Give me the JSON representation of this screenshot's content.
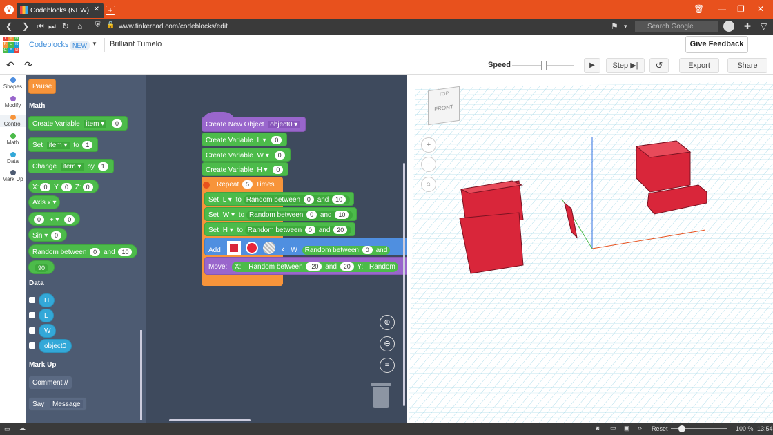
{
  "browser": {
    "tab_title": "Codeblocks (NEW)",
    "url": "www.tinkercad.com/codeblocks/edit",
    "search_placeholder": "Search Google",
    "clock": "13:54",
    "zoom": "100 %",
    "reset_label": "Reset"
  },
  "header": {
    "logo_letters": [
      "T",
      "I",
      "N",
      "K",
      "E",
      "R",
      "C",
      "A",
      "D"
    ],
    "app_name": "Codeblocks",
    "badge": "NEW",
    "project_name": "Brilliant Tumelo",
    "feedback_label": "Give Feedback"
  },
  "toolbar": {
    "speed_label": "Speed",
    "step_label": "Step",
    "export_label": "Export",
    "share_label": "Share"
  },
  "categories": [
    {
      "label": "Shapes",
      "color": "#4f8fe0"
    },
    {
      "label": "Modify",
      "color": "#9966cc"
    },
    {
      "label": "Control",
      "color": "#f7943a"
    },
    {
      "label": "Math",
      "color": "#4cbb4a"
    },
    {
      "label": "Data",
      "color": "#33a8d8"
    },
    {
      "label": "Mark Up",
      "color": "#4d5b72"
    }
  ],
  "palette": {
    "pause": "Pause",
    "math_header": "Math",
    "create_variable": "Create Variable",
    "item": "item",
    "zero": "0",
    "one": "1",
    "set": "Set",
    "to": "to",
    "change": "Change",
    "by": "by",
    "x": "X:",
    "y": "Y:",
    "z": "Z:",
    "axis": "Axis x",
    "plus": "+",
    "sin": "Sin",
    "random_between": "Random between",
    "and": "and",
    "ten": "10",
    "ninety": "90",
    "data_header": "Data",
    "vars": [
      "H",
      "L",
      "W",
      "object0"
    ],
    "markup_header": "Mark Up",
    "comment": "Comment //",
    "say": "Say",
    "message": "Message"
  },
  "script": {
    "create_new_object": "Create New Object",
    "object0": "object0",
    "create_variable": "Create Variable",
    "var_L": "L",
    "var_W": "W",
    "var_H": "H",
    "zero": "0",
    "repeat": "Repeat",
    "repeat_count": "5",
    "times": "Times",
    "set": "Set",
    "to": "to",
    "random_between": "Random between",
    "and": "and",
    "ten": "10",
    "twenty": "20",
    "add": "Add",
    "w_label": "W",
    "ran": "and",
    "move": "Move:",
    "mx": "X:",
    "neg20": "-20",
    "my": "Y:",
    "random_trunc": "Random"
  },
  "viewcube": {
    "top": "TOP",
    "front": "FRONT"
  }
}
